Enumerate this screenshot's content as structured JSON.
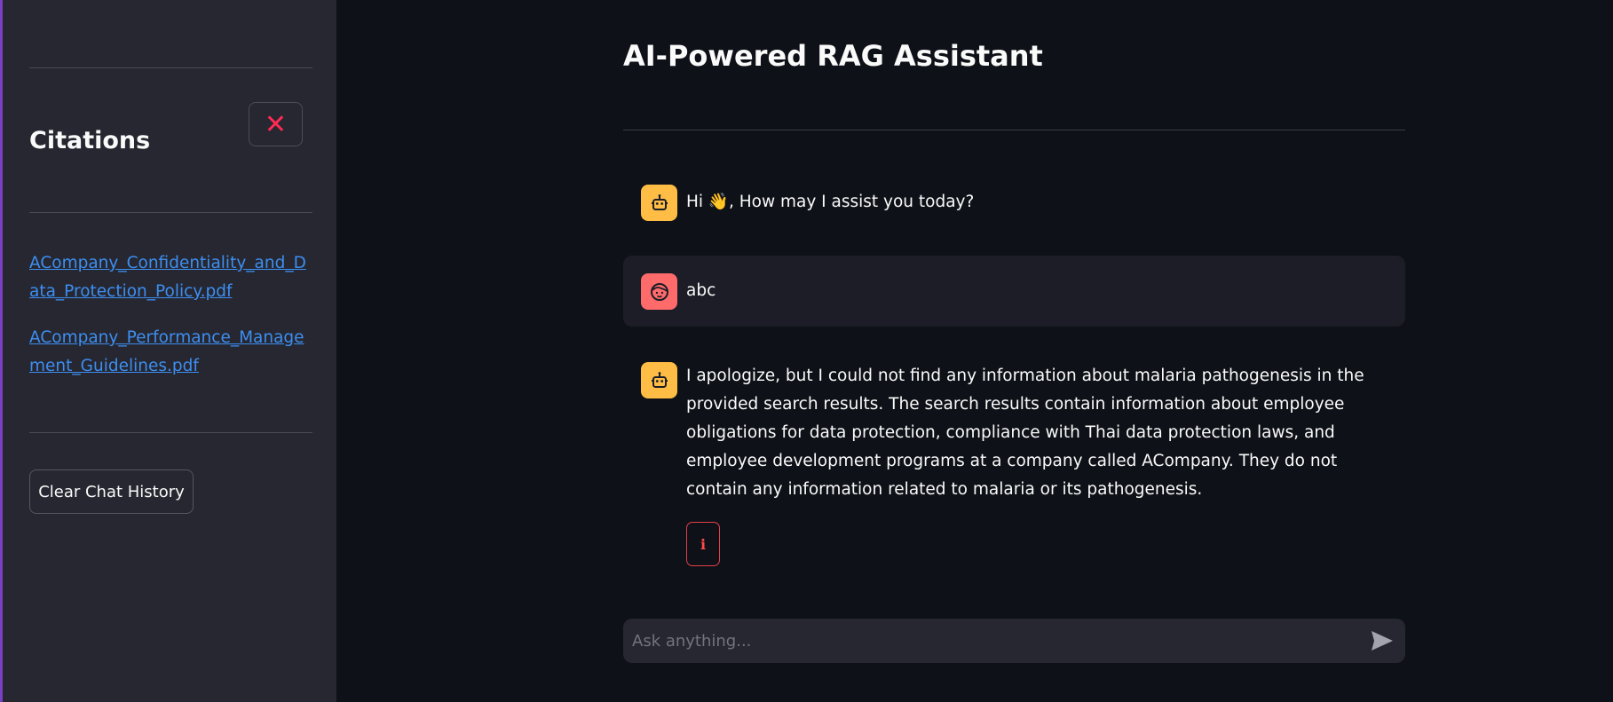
{
  "sidebar": {
    "title": "Citations",
    "close_icon": "close-icon",
    "citations": [
      {
        "label": "ACompany_Confidentiality_and_Data_Protection_Policy.pdf"
      },
      {
        "label": "ACompany_Performance_Management_Guidelines.pdf"
      }
    ],
    "clear_label": "Clear Chat History"
  },
  "main": {
    "title": "AI-Powered RAG Assistant",
    "messages": [
      {
        "role": "assistant",
        "text": "Hi 👋, How may I assist you today?"
      },
      {
        "role": "user",
        "text": "abc"
      },
      {
        "role": "assistant",
        "text": "I apologize, but I could not find any information about malaria pathogenesis in the provided search results. The search results contain information about employee obligations for data protection, compliance with Thai data protection laws, and employee development programs at a company called ACompany. They do not contain any information related to malaria or its pathogenesis."
      }
    ],
    "info_label": "ℹ"
  },
  "chat_input": {
    "placeholder": "Ask anything..."
  },
  "colors": {
    "accent": "#ff2b55",
    "bot_avatar": "#ffbd45",
    "user_avatar": "#ff6b6b",
    "link": "#3d8ef0"
  }
}
